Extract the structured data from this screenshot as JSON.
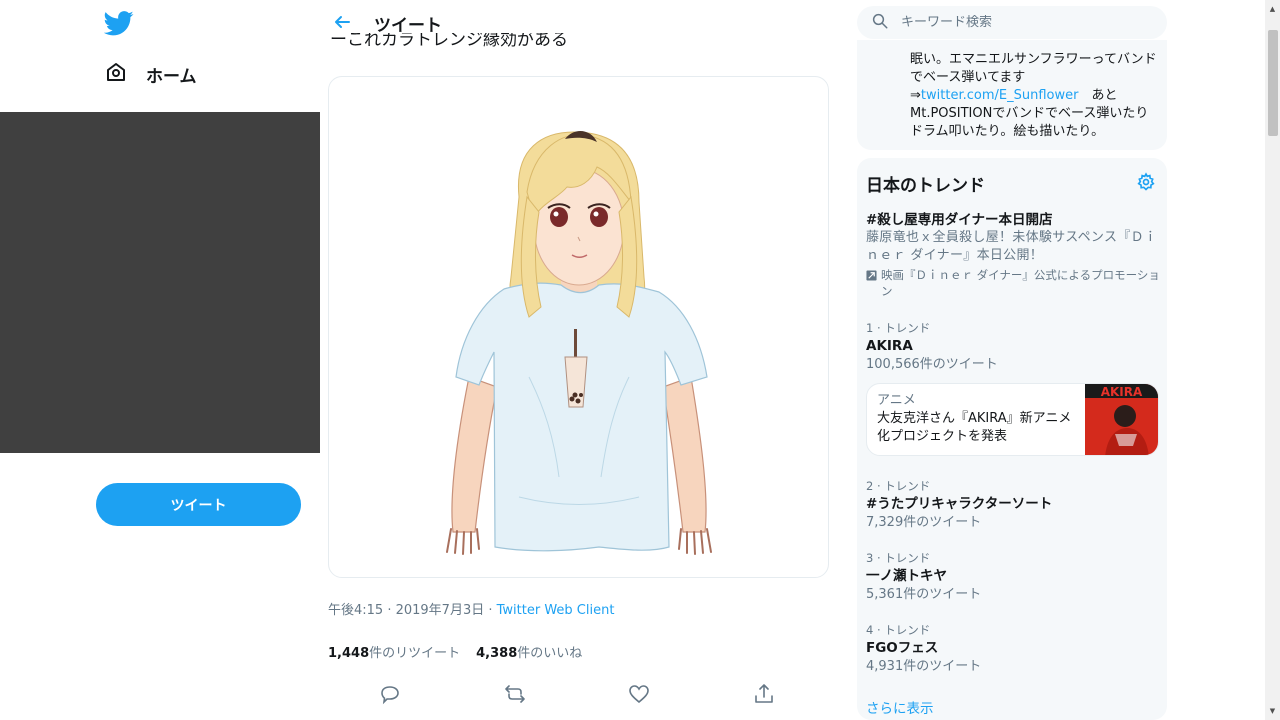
{
  "nav": {
    "home_label": "ホーム",
    "tweet_button": "ツイート"
  },
  "header": {
    "title": "ツイート",
    "clipped_text": "ーこれカラトレンジ縁効がある"
  },
  "tweet": {
    "time": "午後4:15 · 2019年7月3日 · ",
    "client": "Twitter Web Client",
    "retweets_count": "1,448",
    "retweets_label": "件のリツイート",
    "likes_count": "4,388",
    "likes_label": "件のいいね"
  },
  "search": {
    "placeholder": "キーワード検索"
  },
  "bio": {
    "line1": "眠い。エマニエルサンフラワーってバンド",
    "line2": "でベース弾いてます",
    "arrow": "⇒",
    "link": "twitter.com/E_Sunflower",
    "after_link": "　あと",
    "line4": "Mt.POSITIONでバンドでベース弾いたり",
    "line5": "ドラム叩いたり。絵も描いたり。"
  },
  "trends": {
    "title": "日本のトレンド",
    "promoted": {
      "hashtag": "#殺し屋専用ダイナー本日開店",
      "description": "藤原竜也ｘ全員殺し屋！未体験サスペンス『Ｄｉｎｅｒ ダイナー』本日公開！",
      "promo_label": "映画『Ｄｉｎｅｒ ダイナー』公式によるプロモーション"
    },
    "items": [
      {
        "meta": "1 · トレンド",
        "name": "AKIRA",
        "count": "100,566件のツイート"
      },
      {
        "meta": "2 · トレンド",
        "name": "#うたプリキャラクターソート",
        "count": "7,329件のツイート"
      },
      {
        "meta": "3 · トレンド",
        "name": "一ノ瀬トキヤ",
        "count": "5,361件のツイート"
      },
      {
        "meta": "4 · トレンド",
        "name": "FGOフェス",
        "count": "4,931件のツイート"
      }
    ],
    "news": {
      "category": "アニメ",
      "headline": "大友克洋さん『AKIRA』新アニメ化プロジェクトを発表",
      "thumb_text": "AKIRA"
    },
    "show_more": "さらに表示"
  },
  "colors": {
    "accent": "#1da1f2",
    "dark_block": "#404040",
    "muted": "#657786"
  },
  "icons": [
    "twitter-bird-icon",
    "home-icon",
    "back-arrow-icon",
    "search-icon",
    "gear-icon",
    "promoted-icon",
    "reply-icon",
    "retweet-icon",
    "like-icon",
    "share-icon"
  ]
}
